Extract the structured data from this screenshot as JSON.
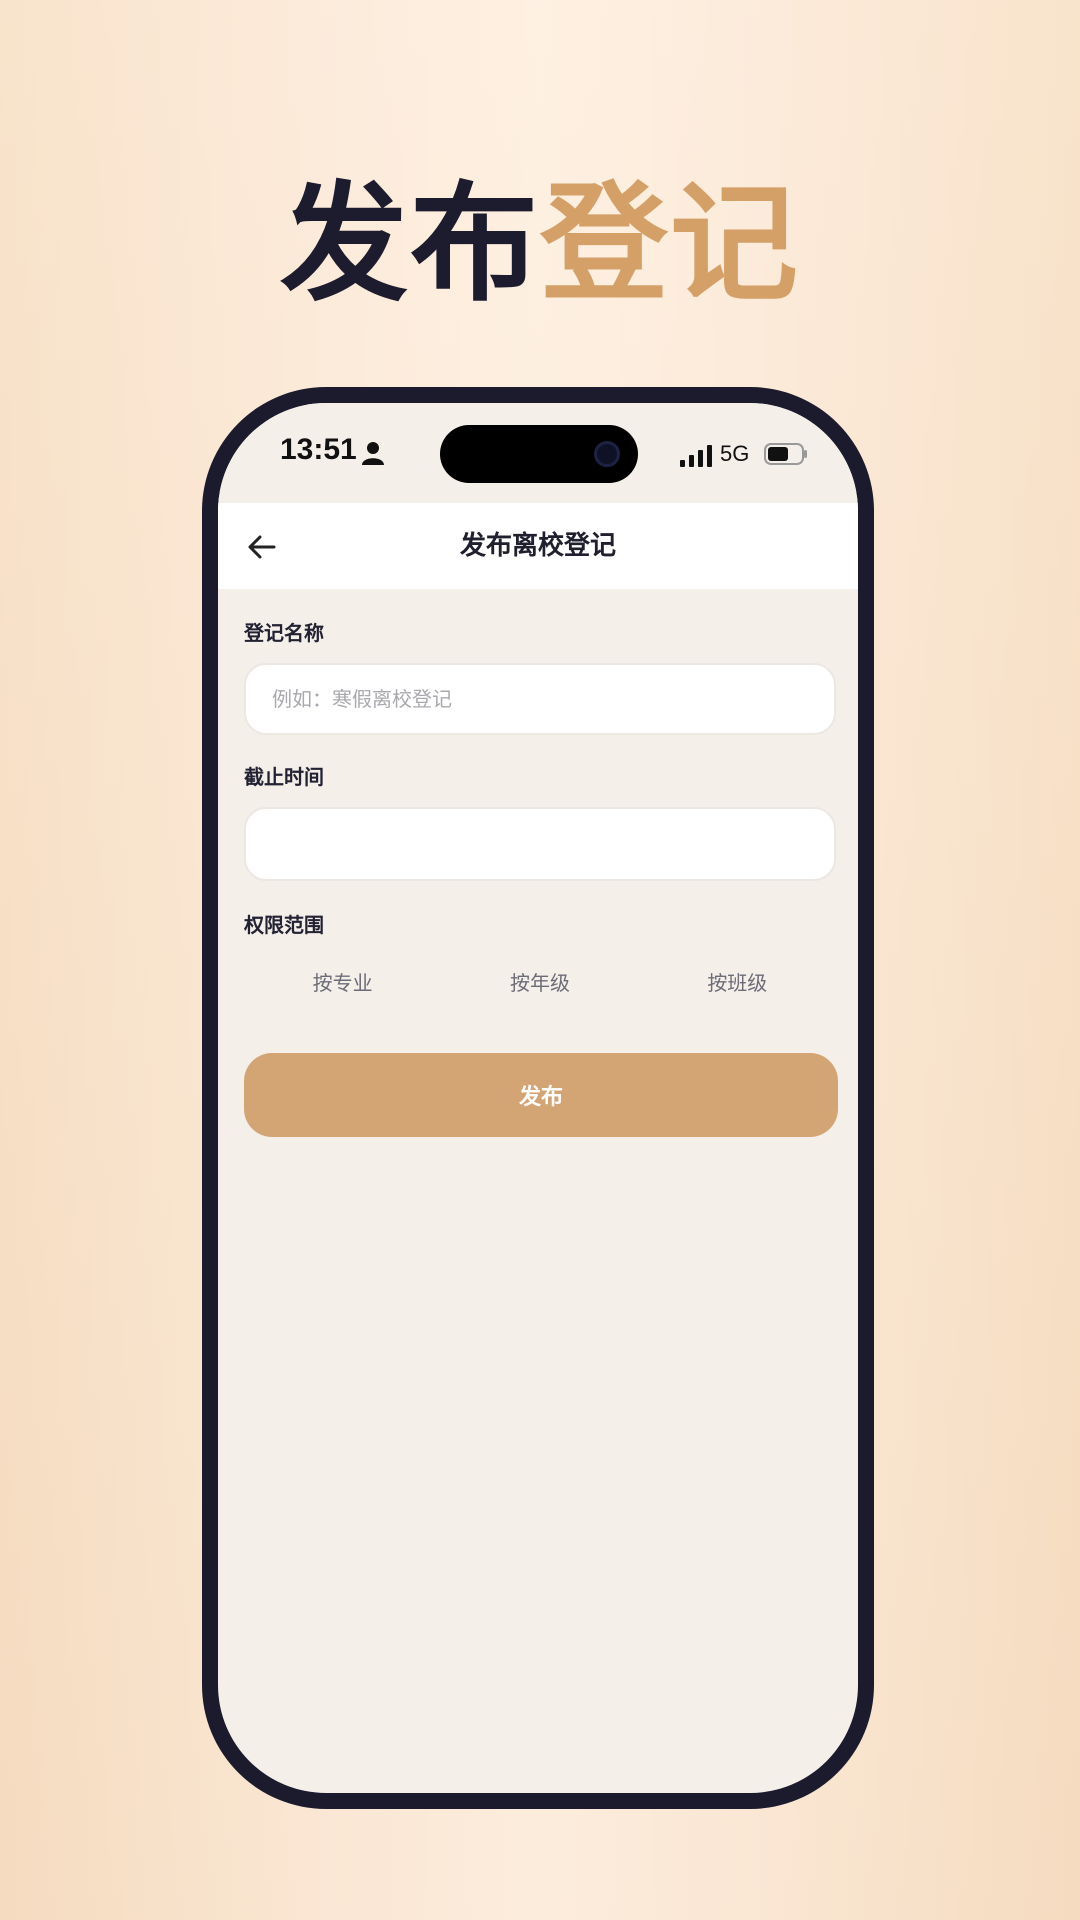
{
  "headline": {
    "part1": "发布",
    "part2": "登记"
  },
  "status_bar": {
    "time": "13:51",
    "network": "5G"
  },
  "nav": {
    "title": "发布离校登记"
  },
  "form": {
    "name_label": "登记名称",
    "name_placeholder": "例如：寒假离校登记",
    "name_value": "",
    "deadline_label": "截止时间",
    "deadline_value": "",
    "scope_label": "权限范围",
    "scope_options": [
      "按专业",
      "按年级",
      "按班级"
    ],
    "submit_label": "发布"
  },
  "colors": {
    "accent": "#d4a574",
    "dark": "#1c1c2e",
    "screen_bg": "#f5efea"
  }
}
